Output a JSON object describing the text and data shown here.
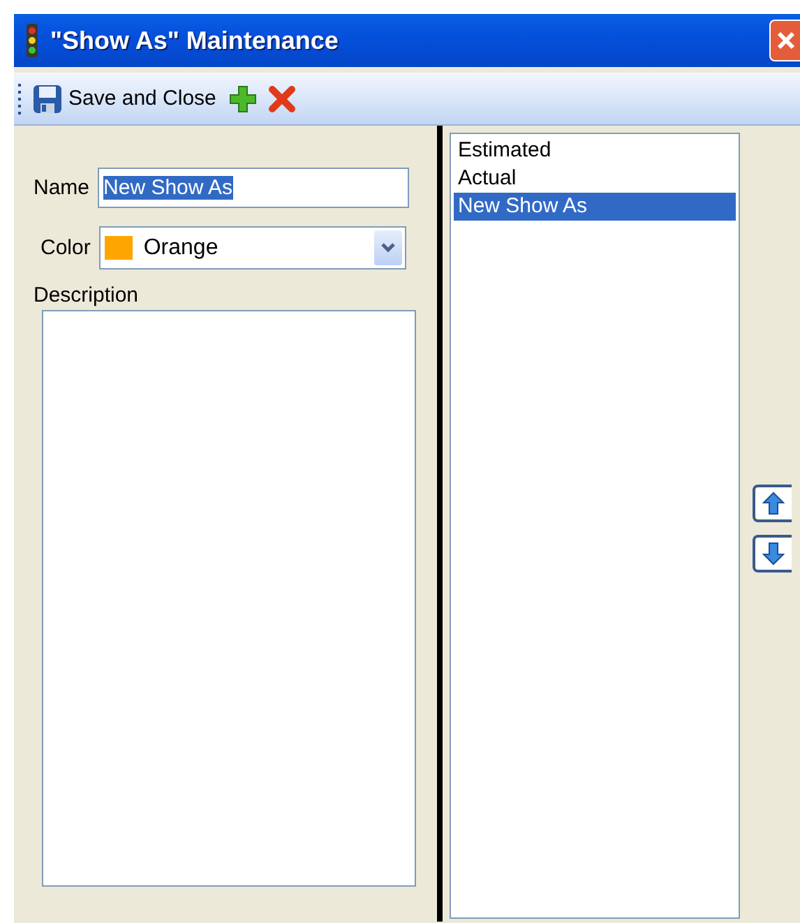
{
  "window": {
    "title": "\"Show As\" Maintenance"
  },
  "toolbar": {
    "save_label": "Save and Close"
  },
  "form": {
    "name_label": "Name",
    "name_value": "New Show As",
    "name_value_selected": true,
    "color_field": {
      "label": "Color",
      "value": "Orange",
      "color": "#ffa500"
    },
    "description_label": "Description"
  },
  "list": {
    "items": [
      {
        "label": "Estimated",
        "selected": false
      },
      {
        "label": "Actual",
        "selected": false
      },
      {
        "label": "New Show As",
        "selected": true
      }
    ]
  }
}
